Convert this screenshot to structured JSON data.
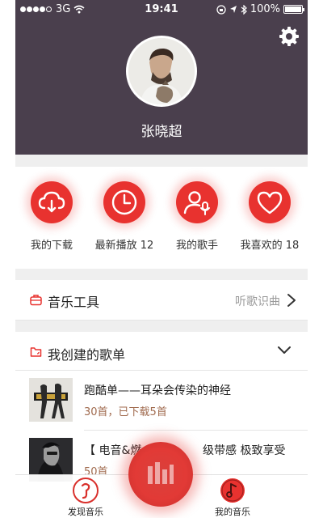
{
  "status_bar": {
    "carrier": "3G",
    "time": "19:41",
    "battery": "100%"
  },
  "profile": {
    "username": "张晓超"
  },
  "quick_actions": [
    {
      "label": "我的下载",
      "icon": "cloud-download-icon"
    },
    {
      "label": "最新播放 12",
      "icon": "clock-icon"
    },
    {
      "label": "我的歌手",
      "icon": "singer-icon"
    },
    {
      "label": "我喜欢的 18",
      "icon": "heart-icon"
    }
  ],
  "tools": {
    "title": "音乐工具",
    "right_label": "听歌识曲"
  },
  "playlists": {
    "title": "我创建的歌单",
    "items": [
      {
        "title": "跑酷单——耳朵会传染的神经",
        "subtitle": "30首，已下载5首"
      },
      {
        "title": "【 电音&燃",
        "title_tail": "级带感 极致享受",
        "subtitle": "50首"
      }
    ]
  },
  "tab_bar": {
    "left": "发现音乐",
    "right": "我的音乐"
  },
  "colors": {
    "header_bg": "#4a3f4d",
    "accent": "#e8322f",
    "subtitle": "#a06a4e"
  }
}
